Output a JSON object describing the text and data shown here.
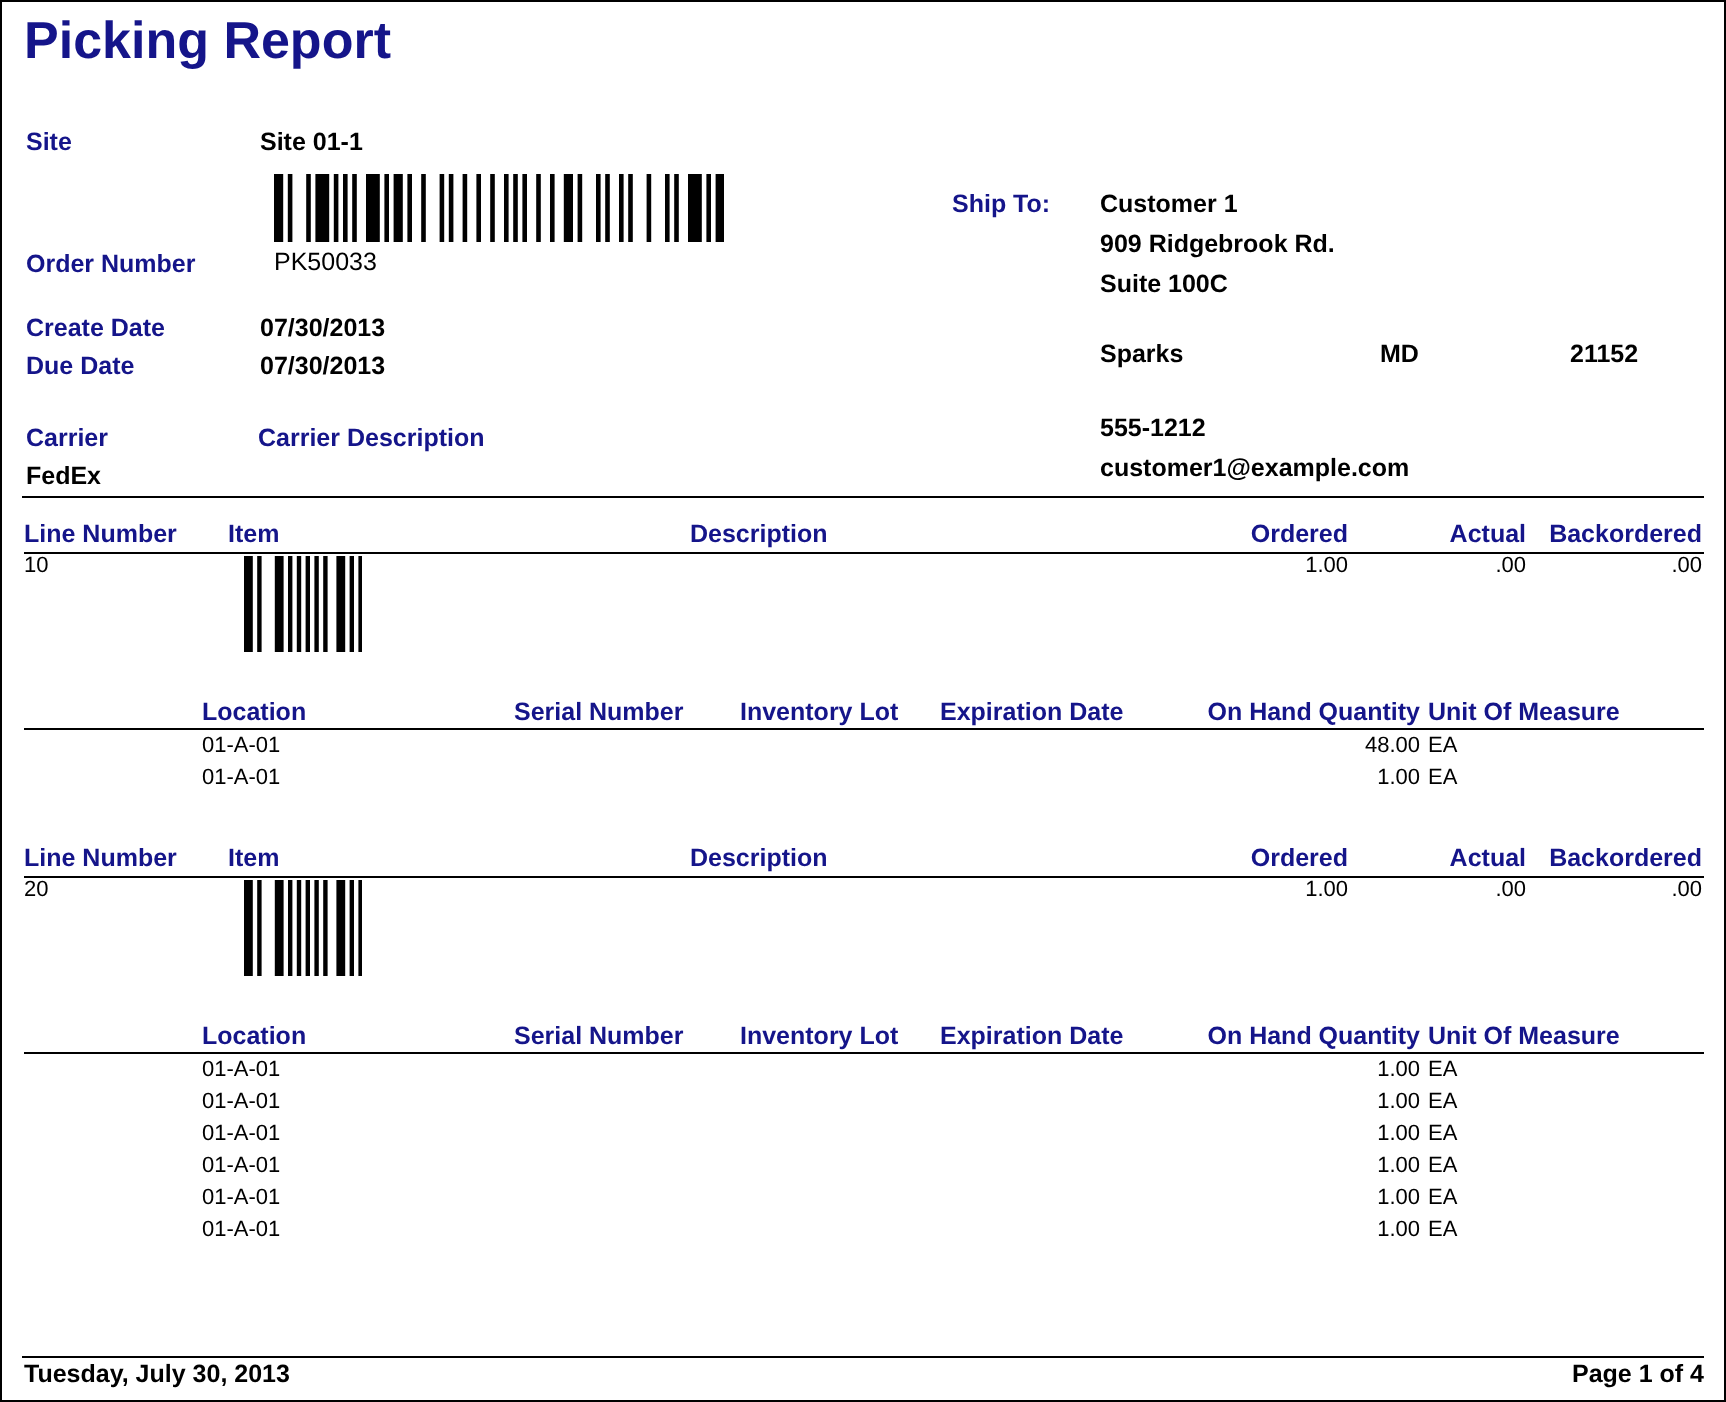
{
  "title": "Picking Report",
  "order": {
    "site": {
      "label": "Site",
      "value": "Site 01-1"
    },
    "order_number": {
      "label": "Order Number",
      "value": "PK50033"
    },
    "create_date": {
      "label": "Create Date",
      "value": "07/30/2013"
    },
    "due_date": {
      "label": "Due Date",
      "value": "07/30/2013"
    },
    "carrier": {
      "label": "Carrier",
      "value": "FedEx"
    },
    "carrier_description": {
      "label": "Carrier Description"
    }
  },
  "ship_to": {
    "label": "Ship To:",
    "name": "Customer 1",
    "address_lines": [
      "909 Ridgebrook Rd.",
      "Suite 100C"
    ],
    "city": "Sparks",
    "state": "MD",
    "zip": "21152",
    "phone": "555-1212",
    "email": "customer1@example.com"
  },
  "lines": [
    {
      "columns": [
        "Line Number",
        "Item",
        "Description",
        "Ordered",
        "Actual",
        "Backordered"
      ],
      "line_number": "10",
      "ordered": "1.00",
      "actual": ".00",
      "backordered": ".00",
      "location_columns": [
        "Location",
        "Serial Number",
        "Inventory Lot",
        "Expiration Date",
        "On Hand Quantity",
        "Unit Of Measure"
      ],
      "locations": [
        {
          "location": "01-A-01",
          "on_hand_quantity": "48.00",
          "unit_of_measure": "EA"
        },
        {
          "location": "01-A-01",
          "on_hand_quantity": "1.00",
          "unit_of_measure": "EA"
        }
      ]
    },
    {
      "columns": [
        "Line Number",
        "Item",
        "Description",
        "Ordered",
        "Actual",
        "Backordered"
      ],
      "line_number": "20",
      "ordered": "1.00",
      "actual": ".00",
      "backordered": ".00",
      "location_columns": [
        "Location",
        "Serial Number",
        "Inventory Lot",
        "Expiration Date",
        "On Hand Quantity",
        "Unit Of Measure"
      ],
      "locations": [
        {
          "location": "01-A-01",
          "on_hand_quantity": "1.00",
          "unit_of_measure": "EA"
        },
        {
          "location": "01-A-01",
          "on_hand_quantity": "1.00",
          "unit_of_measure": "EA"
        },
        {
          "location": "01-A-01",
          "on_hand_quantity": "1.00",
          "unit_of_measure": "EA"
        },
        {
          "location": "01-A-01",
          "on_hand_quantity": "1.00",
          "unit_of_measure": "EA"
        },
        {
          "location": "01-A-01",
          "on_hand_quantity": "1.00",
          "unit_of_measure": "EA"
        },
        {
          "location": "01-A-01",
          "on_hand_quantity": "1.00",
          "unit_of_measure": "EA"
        }
      ]
    }
  ],
  "footer": {
    "date": "Tuesday, July 30, 2013",
    "page": "Page 1 of 4"
  }
}
